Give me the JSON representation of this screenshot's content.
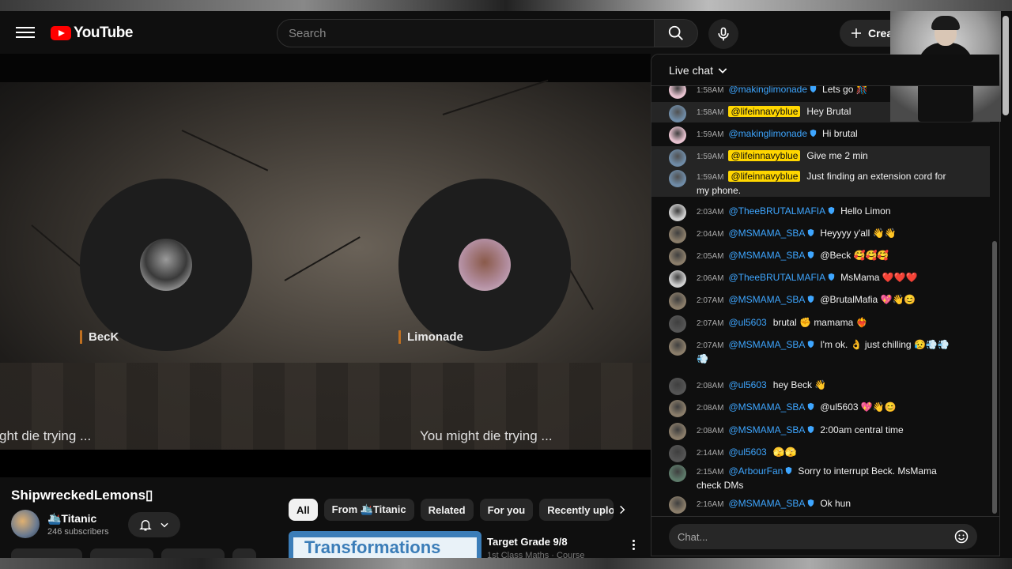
{
  "header": {
    "logo_text": "YouTube",
    "search_placeholder": "Search",
    "create_label": "Creat"
  },
  "video": {
    "participants": [
      {
        "name": "BecK"
      },
      {
        "name": "Limonade"
      }
    ],
    "captions": [
      "ght die trying ...",
      "You might die trying ..."
    ]
  },
  "channel": {
    "title": "ShipwreckedLemons▯",
    "name": "🛳️Titanic",
    "subscribers": "246 subscribers"
  },
  "chips": [
    {
      "label": "All",
      "active": true
    },
    {
      "label": "From 🛳️Titanic"
    },
    {
      "label": "Related"
    },
    {
      "label": "For you"
    },
    {
      "label": "Recently uploa"
    }
  ],
  "recommendation": {
    "thumbnail_text": "Transformations",
    "title": "Target Grade 9/8",
    "subtitle": "1st Class Maths · Course"
  },
  "chat": {
    "title": "Live chat",
    "input_placeholder": "Chat...",
    "messages": [
      {
        "time": "1:58AM",
        "author": "@makinglimonade",
        "text": "Lets go 🎊",
        "verified": true,
        "owner": false
      },
      {
        "time": "1:58AM",
        "author": "@lifeinnavyblue",
        "text": "Hey Brutal",
        "owner": true
      },
      {
        "time": "1:59AM",
        "author": "@makinglimonade",
        "text": "Hi brutal",
        "verified": true,
        "owner": false
      },
      {
        "time": "1:59AM",
        "author": "@lifeinnavyblue",
        "text": "Give me 2 min",
        "owner": true
      },
      {
        "time": "1:59AM",
        "author": "@lifeinnavyblue",
        "text": "Just finding an extension cord for my phone.",
        "owner": true
      },
      {
        "time": "2:03AM",
        "author": "@TheeBRUTALMAFIA",
        "text": "Hello Limon",
        "verified": true
      },
      {
        "time": "2:04AM",
        "author": "@MSMAMA_SBA",
        "text": "Heyyyy y'all 👋👋",
        "verified": true
      },
      {
        "time": "2:05AM",
        "author": "@MSMAMA_SBA",
        "text": "@Beck 🥰🥰🥰",
        "verified": true
      },
      {
        "time": "2:06AM",
        "author": "@TheeBRUTALMAFIA",
        "text": "MsMama ❤️❤️❤️",
        "verified": true
      },
      {
        "time": "2:07AM",
        "author": "@MSMAMA_SBA",
        "text": "@BrutalMafia 💖👋😊",
        "verified": true
      },
      {
        "time": "2:07AM",
        "author": "@ul5603",
        "text": "brutal ✊ mamama ❤️‍🔥"
      },
      {
        "time": "2:07AM",
        "author": "@MSMAMA_SBA",
        "text": "I'm ok. 👌 just chilling 😥💨💨💨",
        "verified": true
      },
      {
        "time": "2:08AM",
        "author": "@ul5603",
        "text": "hey Beck 👋"
      },
      {
        "time": "2:08AM",
        "author": "@MSMAMA_SBA",
        "text": "@ul5603 💖👋😊",
        "verified": true
      },
      {
        "time": "2:08AM",
        "author": "@MSMAMA_SBA",
        "text": "2:00am central time",
        "verified": true
      },
      {
        "time": "2:14AM",
        "author": "@ul5603",
        "text": "🫣🫣"
      },
      {
        "time": "2:15AM",
        "author": "@ArbourFan",
        "text": "Sorry to interrupt Beck. MsMama check DMs",
        "verified": true
      },
      {
        "time": "2:16AM",
        "author": "@MSMAMA_SBA",
        "text": "Ok hun",
        "verified": true
      }
    ]
  },
  "colors": {
    "brand_red": "#ff0000",
    "link_blue": "#3ea6ff",
    "owner_yellow": "#ffd600",
    "bg": "#0f0f0f"
  }
}
